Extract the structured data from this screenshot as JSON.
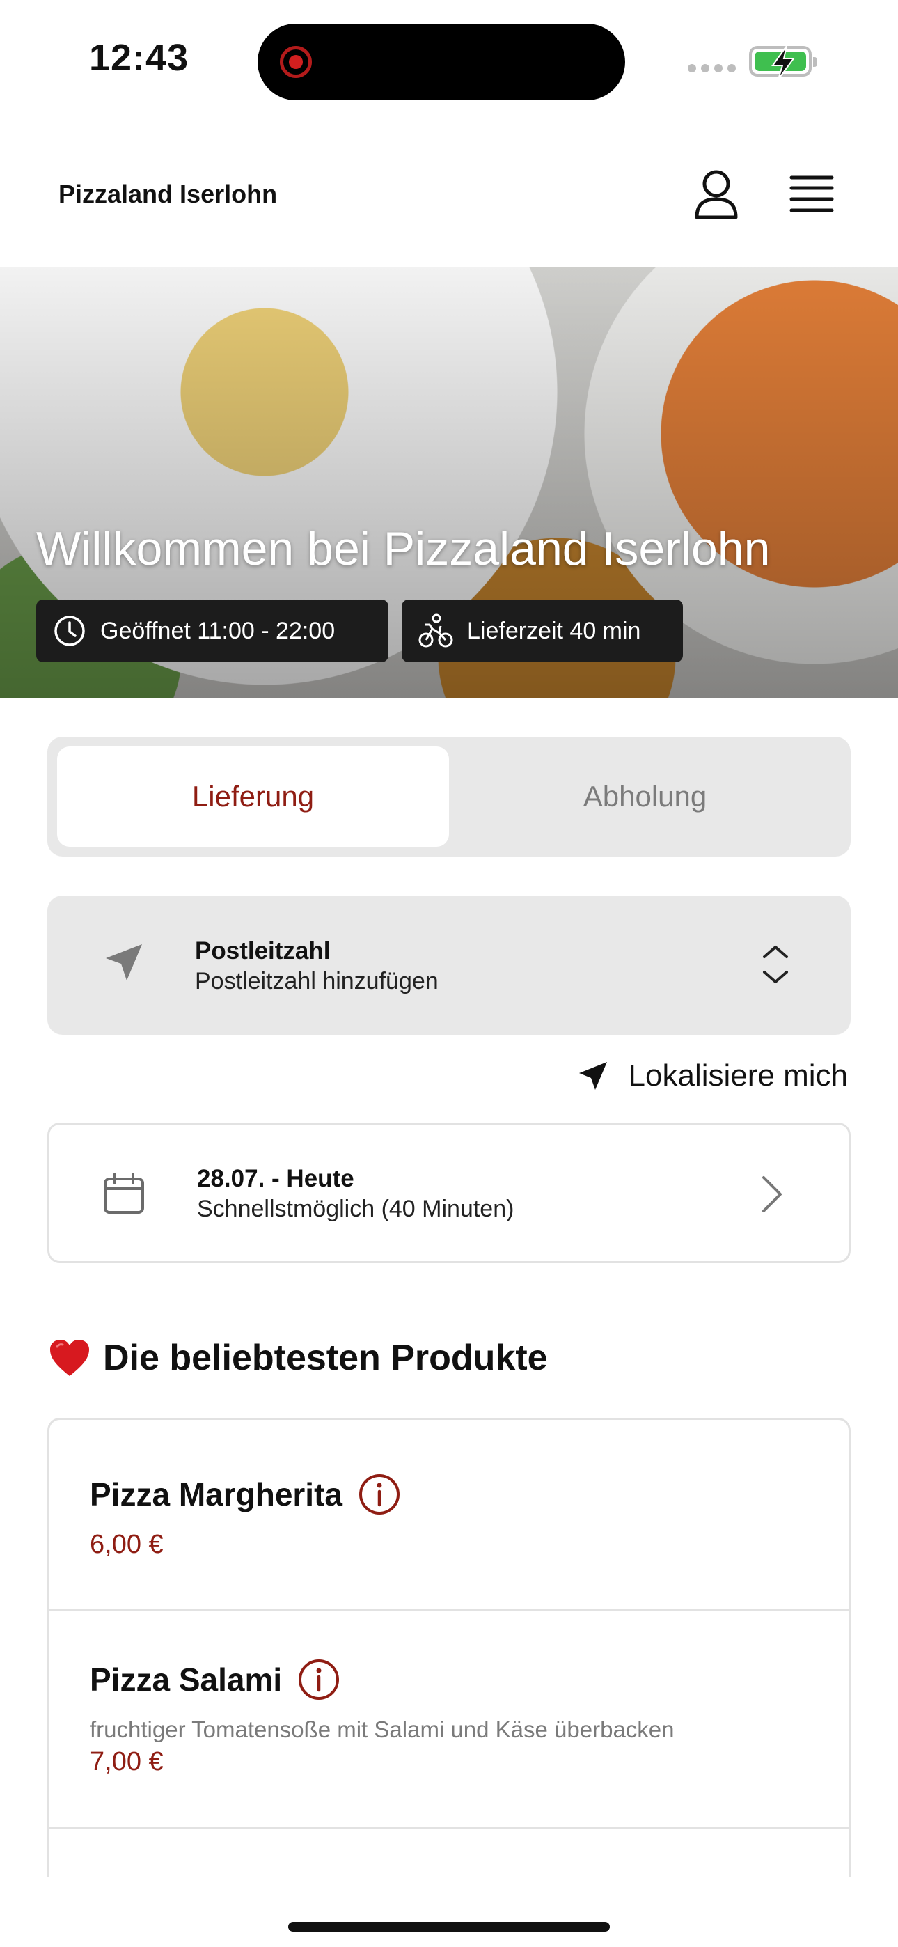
{
  "status_bar": {
    "time": "12:43"
  },
  "header": {
    "brand": "Pizzaland Iserlohn"
  },
  "hero": {
    "title": "Willkommen bei Pizzaland Iserlohn",
    "hours": "Geöffnet 11:00 - 22:00",
    "delivery_time": "Lieferzeit 40 min"
  },
  "tabs": [
    {
      "label": "Lieferung",
      "active": true
    },
    {
      "label": "Abholung",
      "active": false
    }
  ],
  "postcode": {
    "title": "Postleitzahl",
    "placeholder": "Postleitzahl hinzufügen"
  },
  "locate": {
    "label": "Lokalisiere mich"
  },
  "date": {
    "title": "28.07. - Heute",
    "subtitle": "Schnellstmöglich (40 Minuten)"
  },
  "popular": {
    "heading": "Die beliebtesten Produkte",
    "products": [
      {
        "name": "Pizza Margherita",
        "description": "",
        "price": "6,00 €"
      },
      {
        "name": "Pizza Salami",
        "description": "fruchtiger Tomatensoße mit Salami und Käse überbacken",
        "price": "7,00 €"
      }
    ]
  },
  "colors": {
    "accent": "#8f1d13",
    "panel_bg": "#e8e8e8",
    "border": "#e2e2e2",
    "pill_bg": "#1c1c1c"
  }
}
